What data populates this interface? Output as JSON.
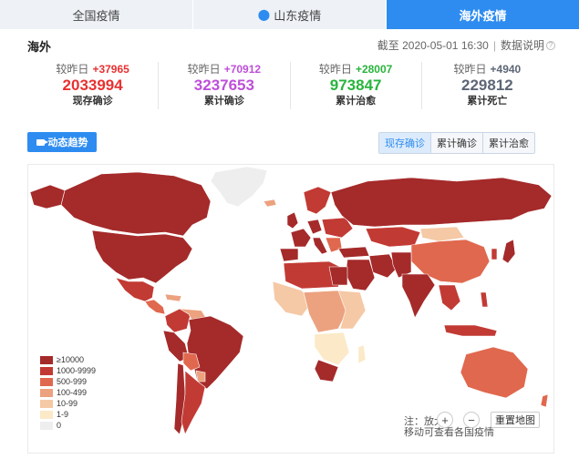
{
  "tabs": [
    {
      "label": "全国疫情"
    },
    {
      "label": "山东疫情",
      "icon": "location-pin-icon"
    },
    {
      "label": "海外疫情"
    }
  ],
  "header": {
    "region": "海外",
    "deadline": "截至 2020-05-01 16:30",
    "explain": "数据说明"
  },
  "stats": [
    {
      "prefix": "较昨日",
      "delta": "+37965",
      "value": "2033994",
      "label": "现存确诊",
      "color": "#e83132"
    },
    {
      "prefix": "较昨日",
      "delta": "+70912",
      "value": "3237653",
      "label": "累计确诊",
      "color": "#be4fd9"
    },
    {
      "prefix": "较昨日",
      "delta": "+28007",
      "value": "973847",
      "label": "累计治愈",
      "color": "#28b43c"
    },
    {
      "prefix": "较昨日",
      "delta": "+4940",
      "value": "229812",
      "label": "累计死亡",
      "color": "#5d6677"
    }
  ],
  "trend_button": "动态趋势",
  "metric_tabs": [
    {
      "label": "现存确诊",
      "active": true
    },
    {
      "label": "累计确诊"
    },
    {
      "label": "累计治愈"
    }
  ],
  "legend": [
    {
      "label": "≥10000",
      "color": "#a52a2a"
    },
    {
      "label": "1000-9999",
      "color": "#c23a34"
    },
    {
      "label": "500-999",
      "color": "#e0684e"
    },
    {
      "label": "100-499",
      "color": "#eca27f"
    },
    {
      "label": "10-99",
      "color": "#f5c9a6"
    },
    {
      "label": "1-9",
      "color": "#fbe9c8"
    },
    {
      "label": "0",
      "color": "#eeeeee"
    }
  ],
  "map_note": "注：放大\n移动可查看各国疫情",
  "controls": {
    "zoom_in": "+",
    "zoom_out": "−",
    "reset": "重置地图"
  }
}
